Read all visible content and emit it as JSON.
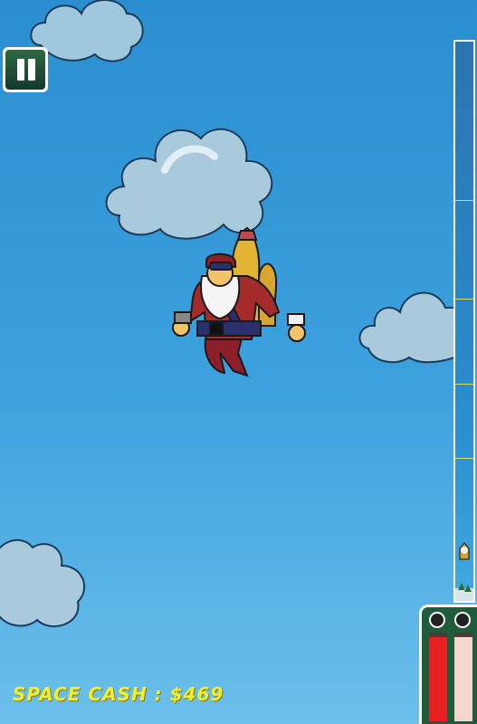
{
  "hud": {
    "pause_icon": "pause-icon",
    "space_cash_text": "SPACE CASH : $469",
    "fuel_gauge": {
      "left_level": 0.95,
      "right_level": 0.95,
      "left_color": "#e62020",
      "right_color": "#f3d7cf"
    }
  },
  "progress_track": {
    "player_progress": 0.1
  },
  "colors": {
    "sky": "#3ea2de",
    "cash_text": "#f4ee2a",
    "hud_green": "#1f5c3b"
  }
}
